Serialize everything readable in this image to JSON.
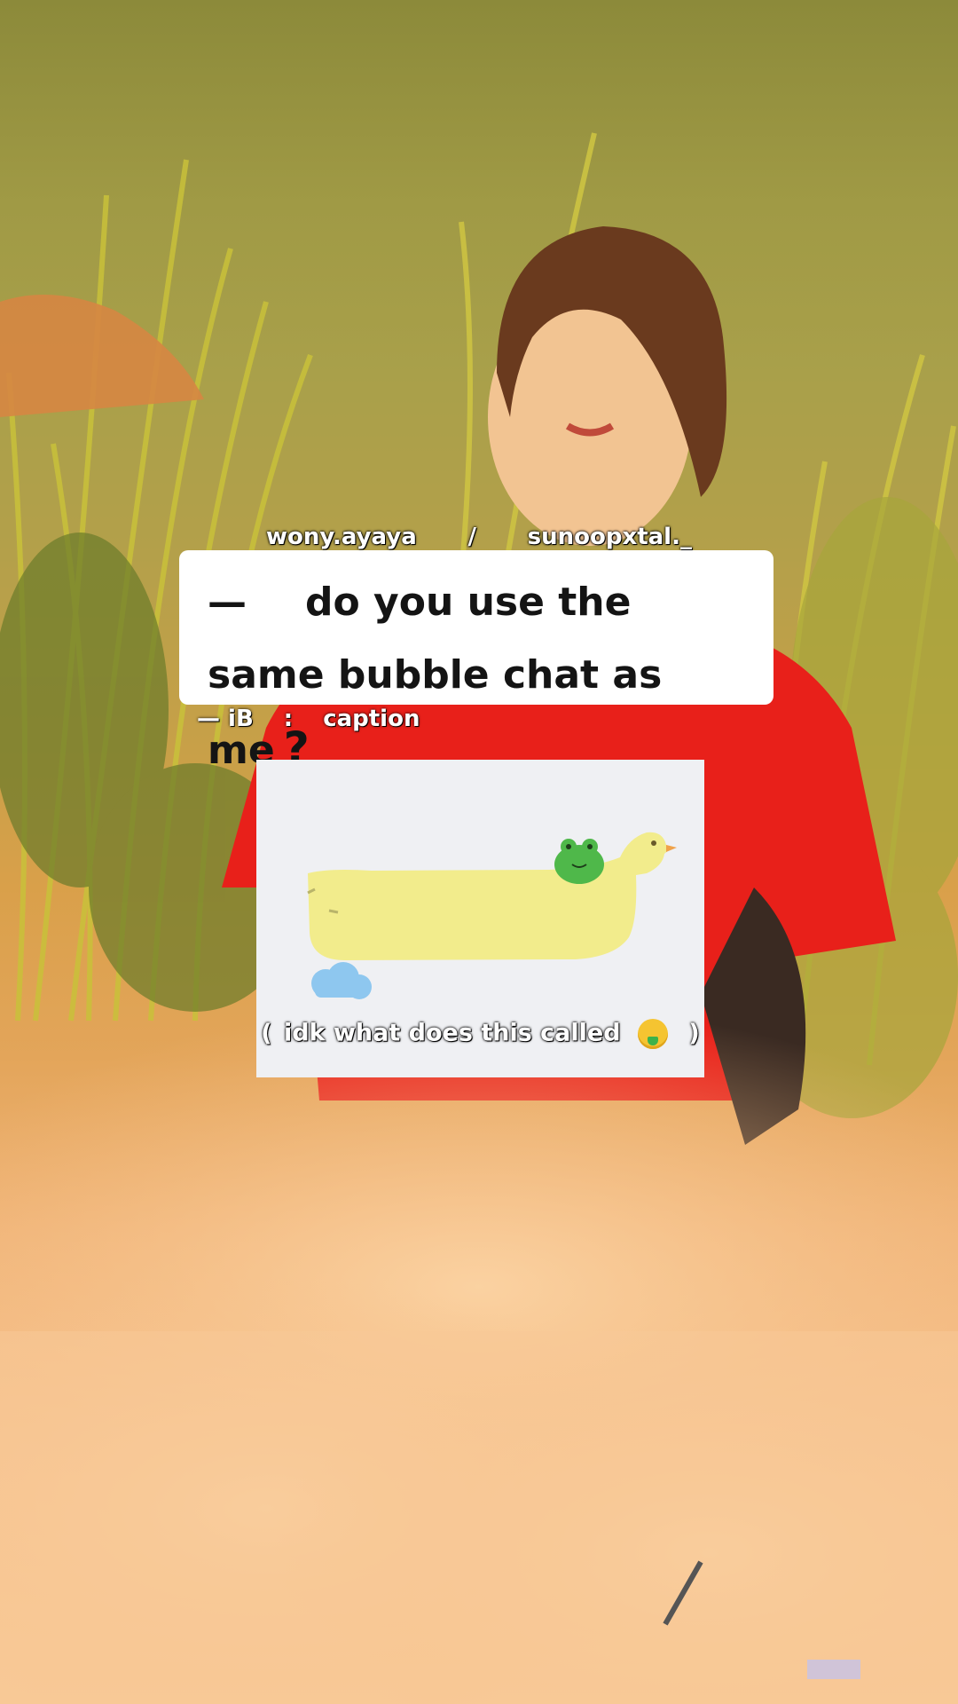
{
  "credits": {
    "left_handle": "wony.ayaya",
    "separator": "/",
    "right_handle": "sunoopxtal._"
  },
  "question": {
    "dash": "—",
    "text": "do you use the same bubble chat as me",
    "mark": "?"
  },
  "caption_line": {
    "prefix": "— iB",
    "separator": ":",
    "label": "caption"
  },
  "example": {
    "open_paren": "(",
    "note": "idk what does this called",
    "emoji": "money-mouth-face-emoji",
    "close_paren": ")"
  },
  "colors": {
    "card_bg": "#ffffff",
    "bubble_yellow": "#f2ec8c",
    "frog_green": "#4fb84a",
    "cloud_blue": "#8ec7ef",
    "shirt_red": "#e8201a"
  }
}
